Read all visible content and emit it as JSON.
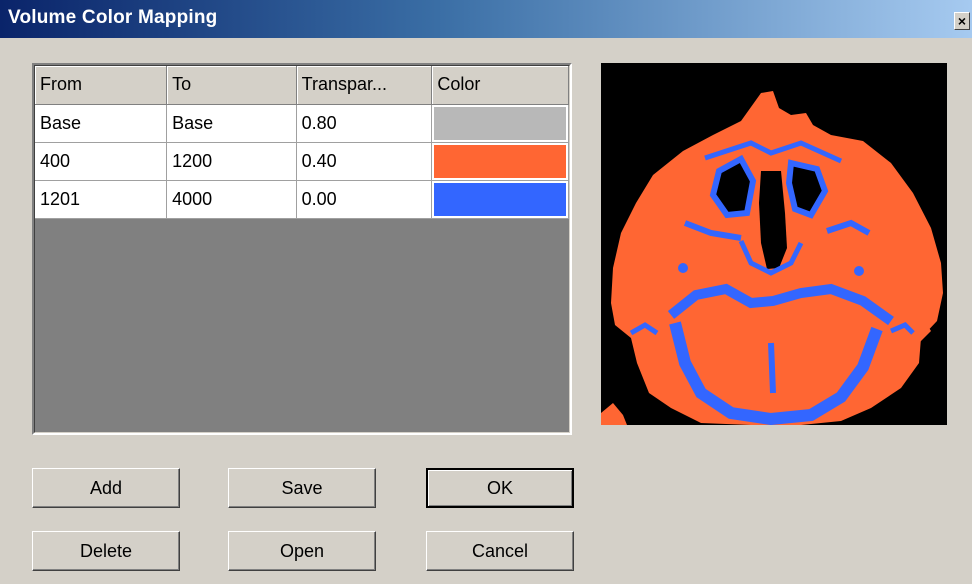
{
  "window": {
    "title": "Volume Color Mapping",
    "close_glyph": "×"
  },
  "table": {
    "columns": [
      "From",
      "To",
      "Transpar...",
      "Color"
    ],
    "rows": [
      {
        "from": "Base",
        "to": "Base",
        "transparency": "0.80",
        "color": "#b8b8b8"
      },
      {
        "from": "400",
        "to": "1200",
        "transparency": "0.40",
        "color": "#ff6633"
      },
      {
        "from": "1201",
        "to": "4000",
        "transparency": "0.00",
        "color": "#3366ff"
      }
    ]
  },
  "buttons": {
    "add": "Add",
    "save": "Save",
    "ok": "OK",
    "delete": "Delete",
    "open": "Open",
    "cancel": "Cancel"
  },
  "preview": {
    "background": "#000000",
    "tissue_color": "#ff6633",
    "bone_color": "#3366ff"
  }
}
